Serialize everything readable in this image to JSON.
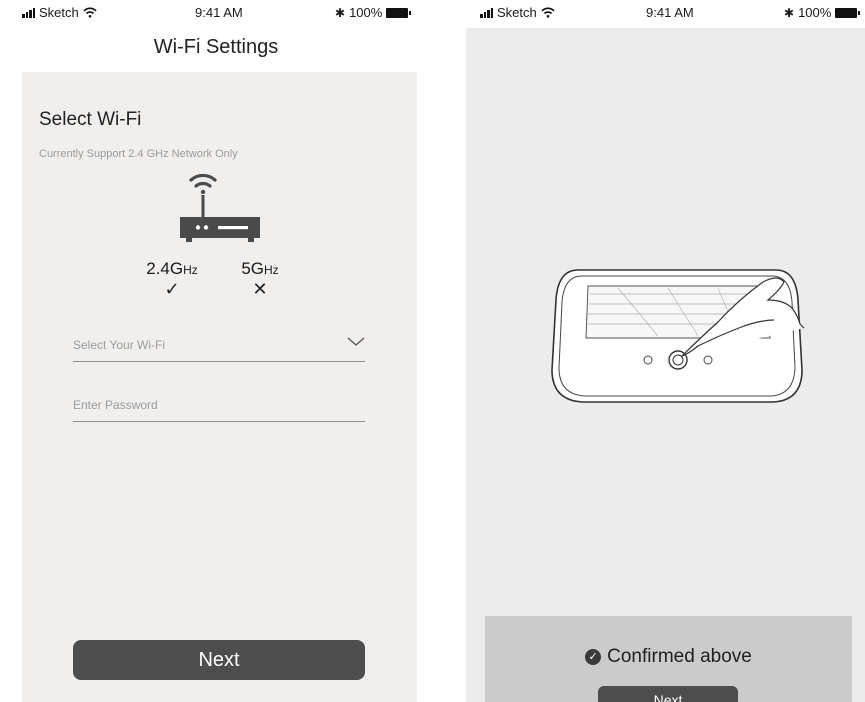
{
  "status_bar": {
    "carrier": "Sketch",
    "time": "9:41 AM",
    "battery": "100%"
  },
  "wifi_settings": {
    "title": "Wi-Fi Settings",
    "section_title": "Select Wi-Fi",
    "subtitle": "Currently Support 2.4 GHz Network Only",
    "bands": [
      {
        "value": "2.4G",
        "unit": "Hz",
        "mark": "✓"
      },
      {
        "value": "5G",
        "unit": "Hz",
        "mark": "✕"
      }
    ],
    "wifi_placeholder": "Select Your Wi-Fi",
    "password_placeholder": "Enter Password",
    "next_label": "Next"
  },
  "device_confirm": {
    "confirm_text": "Confirmed above",
    "next_label": "Next"
  },
  "icons": {
    "wifi": "wifi-icon",
    "router": "router-icon",
    "chevron": "chevron-down-icon",
    "check": "check-circle-icon",
    "bluetooth": "bluetooth-icon",
    "battery": "battery-icon",
    "signal": "signal-icon"
  },
  "colors": {
    "panel_bg": "#f1efed",
    "button_bg": "#4d4d4d",
    "confirm_bar_bg": "#cbcbcb"
  }
}
